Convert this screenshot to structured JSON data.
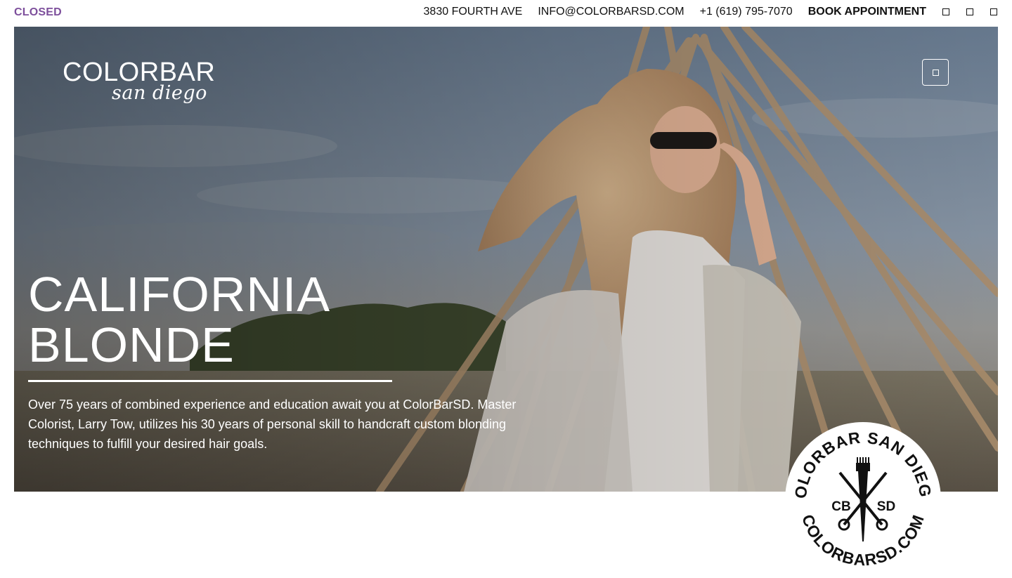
{
  "topbar": {
    "status": "CLOSED",
    "address": "3830 FOURTH AVE",
    "email": "INFO@COLORBARSD.COM",
    "phone": "+1 (619) 795-7070",
    "book": "BOOK APPOINTMENT",
    "social_icons": [
      "social-icon-1",
      "social-icon-2",
      "social-icon-3"
    ]
  },
  "logo": {
    "line1": "COLORBAR",
    "line2": "san diego"
  },
  "hero": {
    "title_line1": "CALIFORNIA",
    "title_line2": "BLONDE",
    "description": "Over 75 years of combined experience and education await you at ColorBarSD. Master Colorist, Larry Tow, utilizes his 30 years of personal skill to handcraft custom blonding techniques to fulfill your desired hair goals."
  },
  "badge": {
    "top_text": "COLORBAR SAN DIEGO",
    "bottom_text": "COLORBARSD.COM",
    "left": "CB",
    "right": "SD"
  },
  "colors": {
    "status": "#7d4f9c",
    "text_dark": "#111111",
    "hero_text": "#ffffff"
  }
}
